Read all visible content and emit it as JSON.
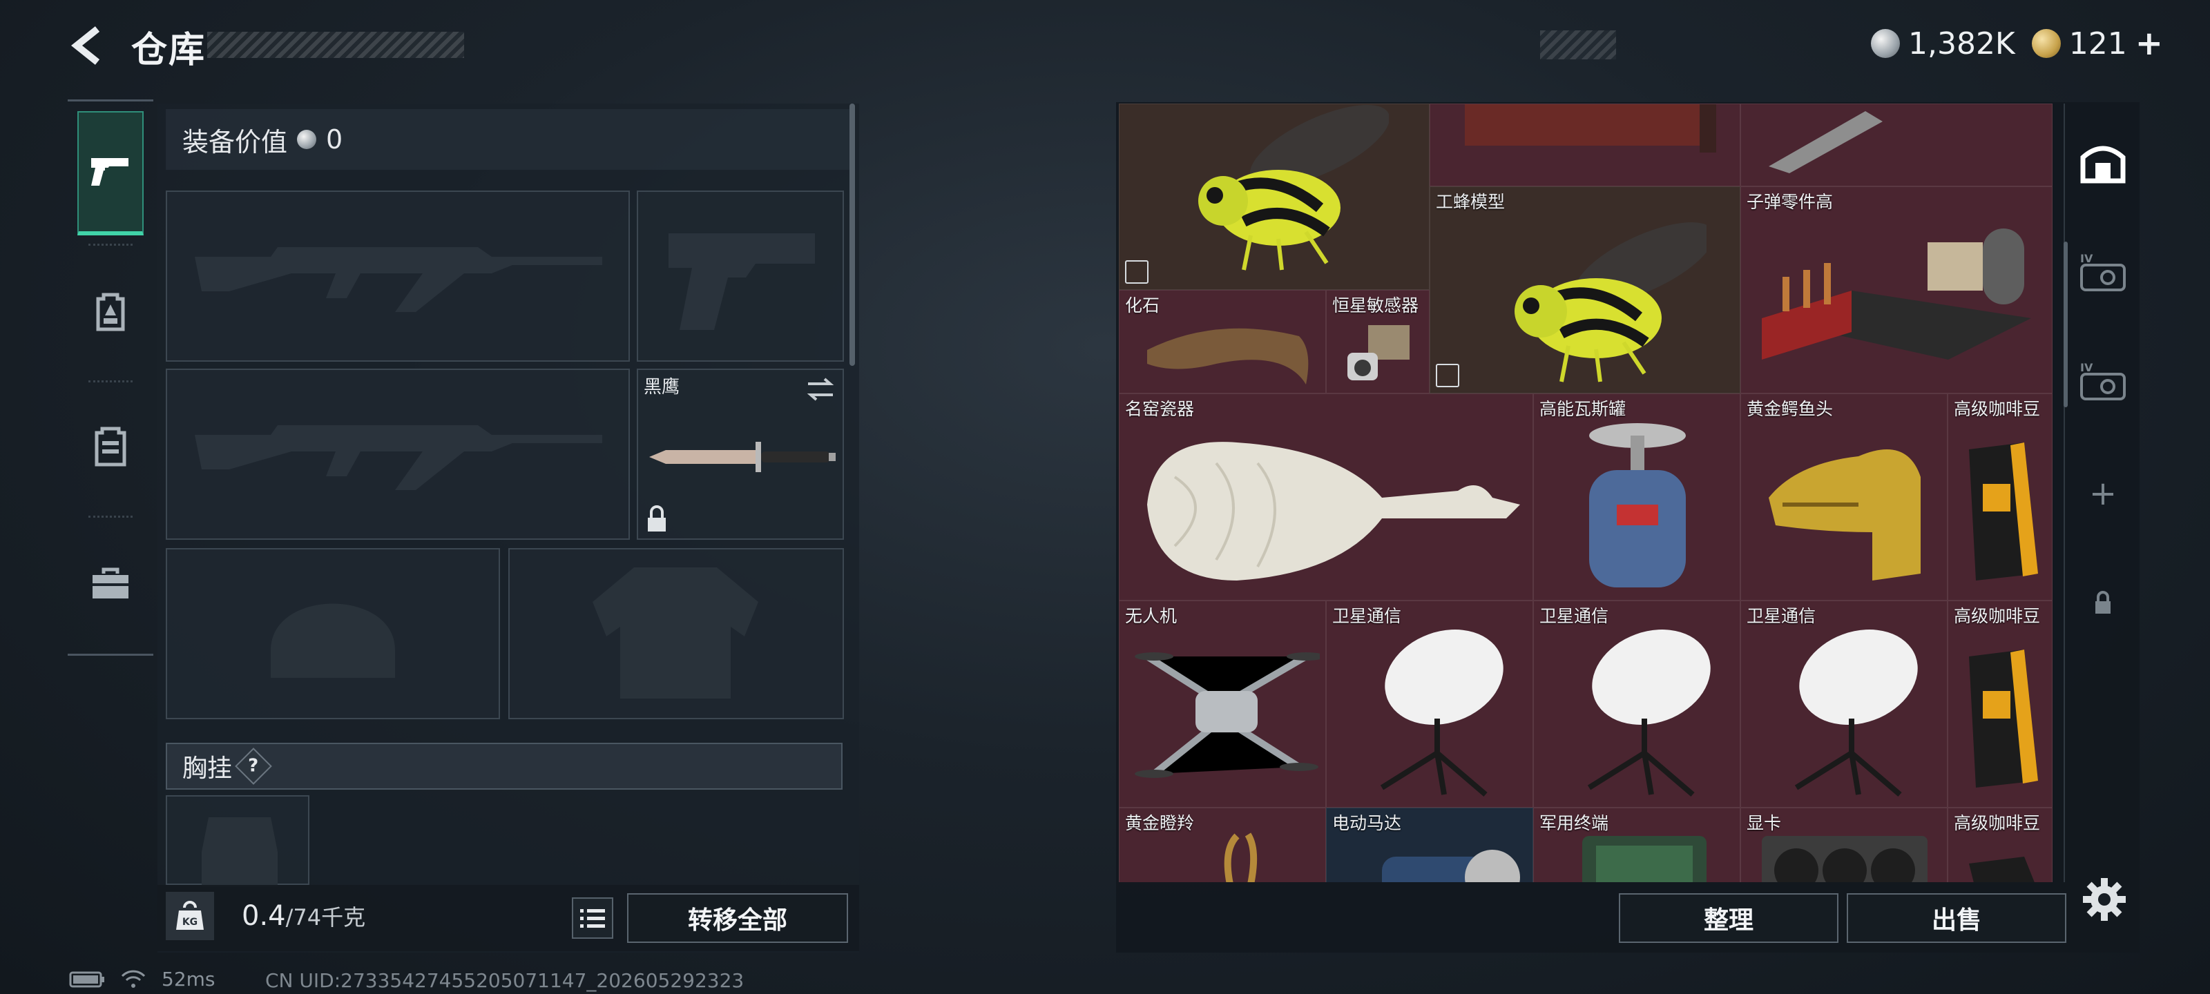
{
  "header": {
    "title": "仓库",
    "silver_amount": "1,382K",
    "gold_amount": "121",
    "add_symbol": "+"
  },
  "rail": {
    "items": [
      {
        "icon": "pistol-icon",
        "active": true
      },
      {
        "icon": "backpack-icon",
        "active": false
      },
      {
        "icon": "vest-icon",
        "active": false
      },
      {
        "icon": "toolbox-icon",
        "active": false
      }
    ]
  },
  "equipment": {
    "value_label": "装备价值",
    "value": "0",
    "melee_label": "黑鹰",
    "chest_label": "胸挂",
    "help_symbol": "?"
  },
  "bottom_bar": {
    "weight_current": "0.4",
    "weight_max": "/74千克",
    "kg_badge": "KG",
    "transfer_all": "转移全部"
  },
  "status": {
    "ping": "52ms",
    "uid": "CN UID:2733542745520507114​7_202605292323"
  },
  "storage": {
    "items": [
      {
        "label": "",
        "icon": "bee-icon"
      },
      {
        "label": "",
        "icon": "red-box-icon"
      },
      {
        "label": "",
        "icon": "bullet-icon"
      },
      {
        "label": "工蜂模型",
        "icon": "bee-icon"
      },
      {
        "label": "子弹零件高",
        "icon": "ammo-crate-icon"
      },
      {
        "label": "化石",
        "icon": "fossil-claw-icon"
      },
      {
        "label": "恒星敏感器",
        "icon": "sensor-icon"
      },
      {
        "label": "名窑瓷器",
        "icon": "porcelain-vase-icon"
      },
      {
        "label": "高能瓦斯罐",
        "icon": "gas-canister-icon"
      },
      {
        "label": "黄金鳄鱼头",
        "icon": "gold-croc-head-icon"
      },
      {
        "label": "高级咖啡豆",
        "icon": "coffee-bag-icon"
      },
      {
        "label": "无人机",
        "icon": "drone-icon"
      },
      {
        "label": "卫星通信",
        "icon": "satellite-dish-icon"
      },
      {
        "label": "卫星通信",
        "icon": "satellite-dish-icon"
      },
      {
        "label": "卫星通信",
        "icon": "satellite-dish-icon"
      },
      {
        "label": "高级咖啡豆",
        "icon": "coffee-bag-icon"
      },
      {
        "label": "黄金瞪羚",
        "icon": "gold-gazelle-icon"
      },
      {
        "label": "电动马达",
        "icon": "motor-icon"
      },
      {
        "label": "军用终端",
        "icon": "terminal-icon"
      },
      {
        "label": "显卡",
        "icon": "graphics-card-icon"
      },
      {
        "label": "高级咖啡豆",
        "icon": "coffee-bag-icon"
      }
    ],
    "side_tabs": [
      "safe-icon",
      "tier-iv-case-icon",
      "tier-iv-case-icon",
      "plus-icon",
      "lock-icon"
    ],
    "tier_label": "IV",
    "plus_symbol": "+"
  },
  "actions": {
    "tidy": "整理",
    "sell": "出售"
  },
  "colors": {
    "accent": "#41d3a8",
    "maroon_cell": "#4a2530",
    "panel": "#192129"
  }
}
